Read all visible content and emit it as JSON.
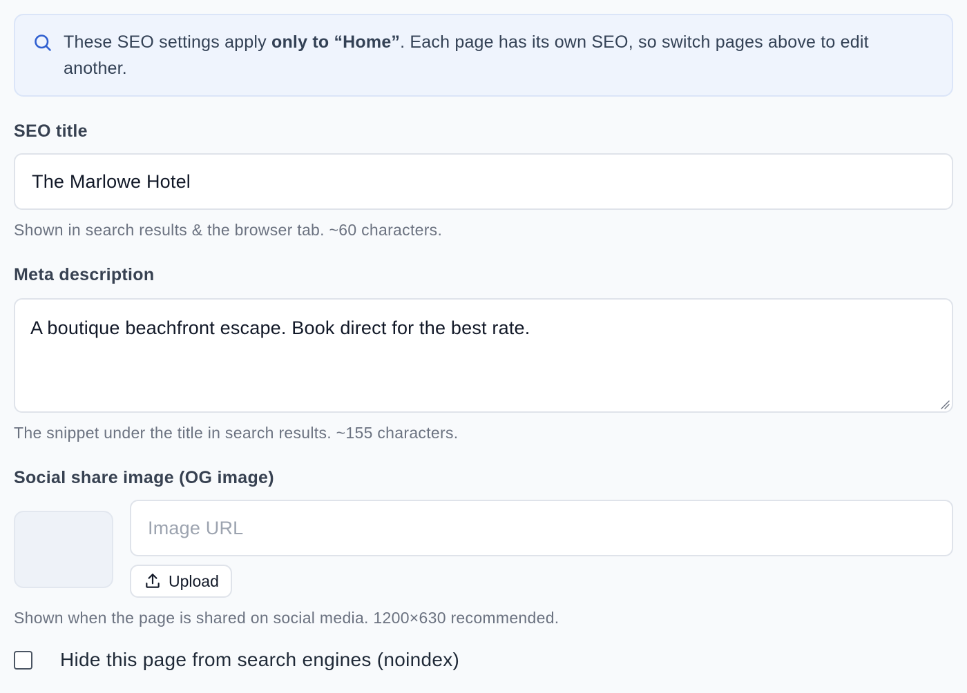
{
  "banner": {
    "icon": "search-icon",
    "text_before": "These SEO settings apply ",
    "text_bold": "only to “Home”",
    "text_after": ". Each page has its own SEO, so switch pages above to edit another."
  },
  "seo_title": {
    "label": "SEO title",
    "value": "The Marlowe Hotel",
    "help": "Shown in search results & the browser tab. ~60 characters."
  },
  "meta_description": {
    "label": "Meta description",
    "value": "A boutique beachfront escape. Book direct for the best rate.",
    "help": "The snippet under the title in search results. ~155 characters."
  },
  "og_image": {
    "label": "Social share image (OG image)",
    "url_placeholder": "Image URL",
    "url_value": "",
    "upload_label": "Upload",
    "upload_icon": "upload-icon",
    "help": "Shown when the page is shared on social media. 1200×630 recommended."
  },
  "noindex": {
    "label": "Hide this page from search engines (noindex)",
    "checked": false
  },
  "colors": {
    "accent": "#2f5fd0",
    "banner_bg": "#eff4fd",
    "page_bg": "#f8fafc"
  }
}
